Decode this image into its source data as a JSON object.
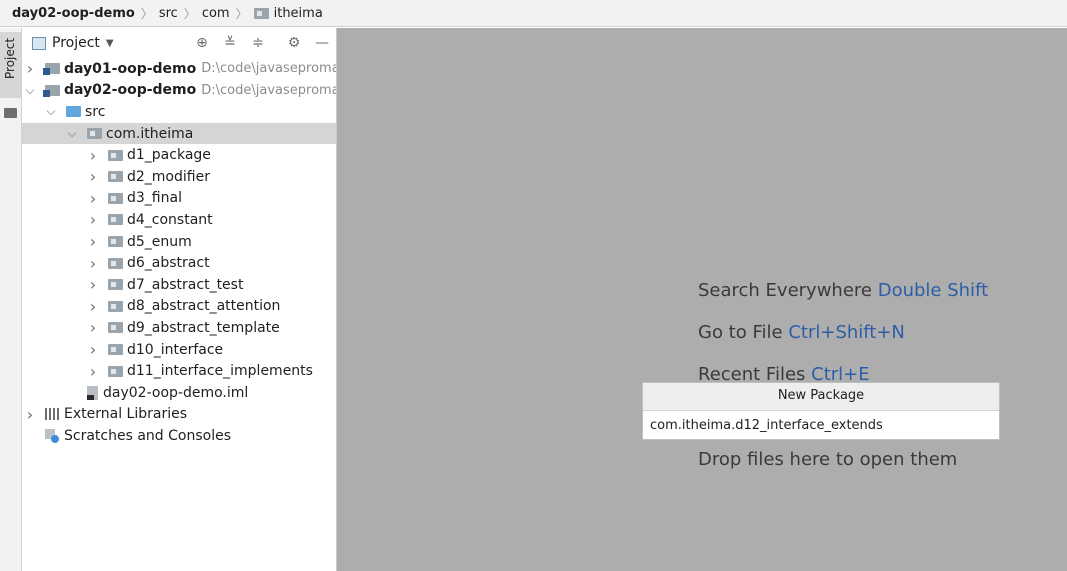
{
  "breadcrumb": [
    "day02-oop-demo",
    "src",
    "com",
    "itheima"
  ],
  "stripe": {
    "project_tab": "Project"
  },
  "panel": {
    "title": "Project"
  },
  "tree": [
    {
      "label": "day01-oop-demo",
      "path": "D:\\code\\javasepromax\\",
      "icon": "module-folder-icon",
      "arrow": "right",
      "bold": true,
      "level": 0
    },
    {
      "label": "day02-oop-demo",
      "path": "D:\\code\\javasepromax\\",
      "icon": "module-folder-icon",
      "arrow": "down",
      "bold": true,
      "level": 0
    },
    {
      "label": "src",
      "icon": "source-folder-icon",
      "arrow": "down",
      "level": 1
    },
    {
      "label": "com.itheima",
      "icon": "package-icon",
      "arrow": "down",
      "level": 2,
      "selected": true
    },
    {
      "label": "d1_package",
      "icon": "package-icon",
      "arrow": "right",
      "level": 3
    },
    {
      "label": "d2_modifier",
      "icon": "package-icon",
      "arrow": "right",
      "level": 3
    },
    {
      "label": "d3_final",
      "icon": "package-icon",
      "arrow": "right",
      "level": 3
    },
    {
      "label": "d4_constant",
      "icon": "package-icon",
      "arrow": "right",
      "level": 3
    },
    {
      "label": "d5_enum",
      "icon": "package-icon",
      "arrow": "right",
      "level": 3
    },
    {
      "label": "d6_abstract",
      "icon": "package-icon",
      "arrow": "right",
      "level": 3
    },
    {
      "label": "d7_abstract_test",
      "icon": "package-icon",
      "arrow": "right",
      "level": 3
    },
    {
      "label": "d8_abstract_attention",
      "icon": "package-icon",
      "arrow": "right",
      "level": 3
    },
    {
      "label": "d9_abstract_template",
      "icon": "package-icon",
      "arrow": "right",
      "level": 3
    },
    {
      "label": "d10_interface",
      "icon": "package-icon",
      "arrow": "right",
      "level": 3
    },
    {
      "label": "d11_interface_implements",
      "icon": "package-icon",
      "arrow": "right",
      "level": 3
    },
    {
      "label": "day02-oop-demo.iml",
      "icon": "iml-file-icon",
      "arrow": "none",
      "level": 2
    },
    {
      "label": "External Libraries",
      "icon": "libraries-icon",
      "arrow": "right",
      "level": 0
    },
    {
      "label": "Scratches and Consoles",
      "icon": "scratches-icon",
      "arrow": "none",
      "level": 0
    }
  ],
  "editor": {
    "hints": [
      {
        "text": "Search Everywhere ",
        "key": "Double Shift"
      },
      {
        "text": "Go to File ",
        "key": "Ctrl+Shift+N"
      },
      {
        "text": "Recent Files ",
        "key": "Ctrl+E"
      },
      {
        "text": "Drop files here to open them",
        "key": ""
      }
    ]
  },
  "dialog": {
    "title": "New Package",
    "value": "com.itheima.d12_interface_extends"
  }
}
